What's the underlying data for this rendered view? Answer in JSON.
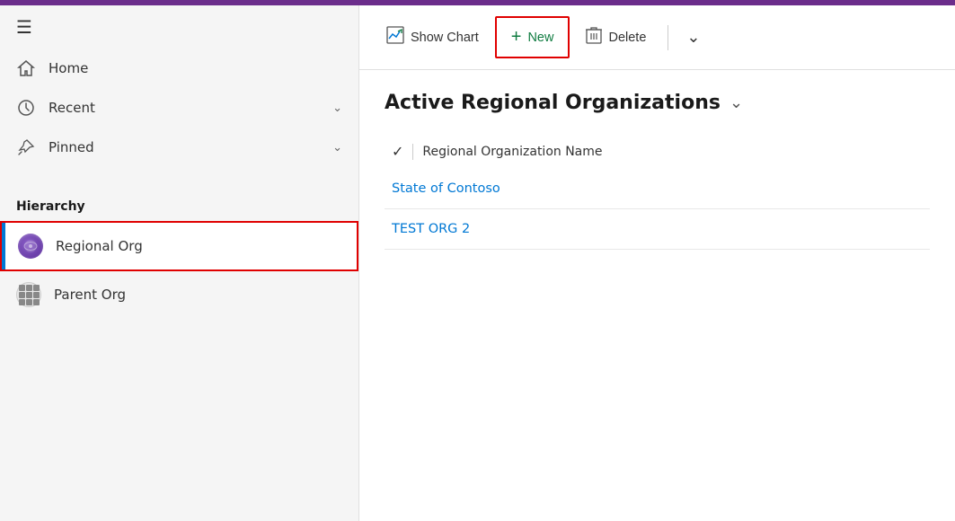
{
  "topbar": {},
  "sidebar": {
    "hamburger": "☰",
    "nav": [
      {
        "id": "home",
        "icon": "⌂",
        "label": "Home",
        "hasChevron": false
      },
      {
        "id": "recent",
        "icon": "🕐",
        "label": "Recent",
        "hasChevron": true
      },
      {
        "id": "pinned",
        "icon": "📌",
        "label": "Pinned",
        "hasChevron": true
      }
    ],
    "section_label": "Hierarchy",
    "hierarchy_items": [
      {
        "id": "regional-org",
        "label": "Regional Org",
        "active": true
      },
      {
        "id": "parent-org",
        "label": "Parent Org",
        "active": false
      }
    ]
  },
  "toolbar": {
    "show_chart_label": "Show Chart",
    "new_label": "New",
    "delete_label": "Delete"
  },
  "main": {
    "view_title": "Active Regional Organizations",
    "table": {
      "column_header": "Regional Organization Name",
      "rows": [
        {
          "id": "row1",
          "name": "State of Contoso"
        },
        {
          "id": "row2",
          "name": "TEST ORG 2"
        }
      ]
    }
  }
}
